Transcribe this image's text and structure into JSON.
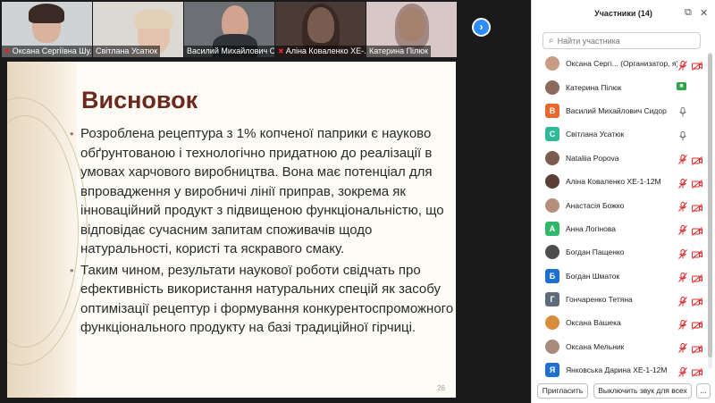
{
  "video_strip": {
    "tiles": [
      {
        "name": "Оксана Сергіївна Шу..."
      },
      {
        "name": "Світлана Усатюк"
      },
      {
        "name": "Василий Михайлович С..."
      },
      {
        "name": "Аліна Коваленко ХЕ-..."
      },
      {
        "name": "Катерина Пілюк"
      }
    ],
    "next_icon": "chevron-right-icon"
  },
  "slide": {
    "title": "Висновок",
    "bullets": [
      "Розроблена рецептура з 1% копченої паприки є науково обґрунтованою і технологічно придатною до реалізації в умовах харчового виробництва. Вона має потенціал для впровадження у виробничі лінії приправ, зокрема як інноваційний продукт з підвищеною функціональністю, що відповідає сучасним запитам споживачів щодо натуральності, користі та яскравого смаку.",
      "Таким чином, результати наукової роботи свідчать про ефективність використання натуральних спецій як засобу оптимізації рецептур і формування конкурентоспроможного функціонального продукту на базі традиційної гірчиці."
    ],
    "page_number": "26"
  },
  "participants": {
    "title": "Участники (14)",
    "search_placeholder": "Найти участника",
    "list": [
      {
        "name": "Оксана Сергі... (Организатор, я)",
        "avatar": "photo",
        "avatar_color": "#c99b85",
        "mic": "off",
        "cam": "off"
      },
      {
        "name": "Катерина Пілюк",
        "avatar": "photo",
        "avatar_color": "#8a6a5c",
        "mic": "none",
        "cam": "on"
      },
      {
        "name": "Василий Михайлович Сидор",
        "avatar": "В",
        "avatar_color": "#e8692b",
        "mic": "on",
        "cam": "none"
      },
      {
        "name": "Світлана Усатюк",
        "avatar": "С",
        "avatar_color": "#2fb89a",
        "mic": "on",
        "cam": "none"
      },
      {
        "name": "Nataliia Popova",
        "avatar": "photo",
        "avatar_color": "#7b5c4e",
        "mic": "off",
        "cam": "off"
      },
      {
        "name": "Аліна Коваленко ХЕ-1-12М",
        "avatar": "photo",
        "avatar_color": "#5b3f36",
        "mic": "off",
        "cam": "off"
      },
      {
        "name": "Анастасія Божко",
        "avatar": "photo",
        "avatar_color": "#b58f7c",
        "mic": "off",
        "cam": "off"
      },
      {
        "name": "Анна Логінова",
        "avatar": "А",
        "avatar_color": "#2fb86a",
        "mic": "off",
        "cam": "off"
      },
      {
        "name": "Богдан Пащенко",
        "avatar": "photo",
        "avatar_color": "#4d4d4d",
        "mic": "off",
        "cam": "off"
      },
      {
        "name": "Богдан Шматок",
        "avatar": "Б",
        "avatar_color": "#1f6fd1",
        "mic": "off",
        "cam": "off"
      },
      {
        "name": "Гончаренко Тетяна",
        "avatar": "Г",
        "avatar_color": "#5d6d7e",
        "mic": "off",
        "cam": "off"
      },
      {
        "name": "Оксана Вашека",
        "avatar": "photo",
        "avatar_color": "#d98c3a",
        "mic": "off",
        "cam": "off"
      },
      {
        "name": "Оксана Мельник",
        "avatar": "photo",
        "avatar_color": "#a88b7a",
        "mic": "off",
        "cam": "off"
      },
      {
        "name": "Янковська Дарина ХЕ-1-12М",
        "avatar": "Я",
        "avatar_color": "#1f6fd1",
        "mic": "off",
        "cam": "off"
      }
    ],
    "invite_label": "Пригласить",
    "mute_all_label": "Выключить звук для всех",
    "more_label": "..."
  },
  "colors": {
    "accent": "#2d8cff",
    "muted_red": "#e02828",
    "title_brown": "#6b2a1d"
  }
}
